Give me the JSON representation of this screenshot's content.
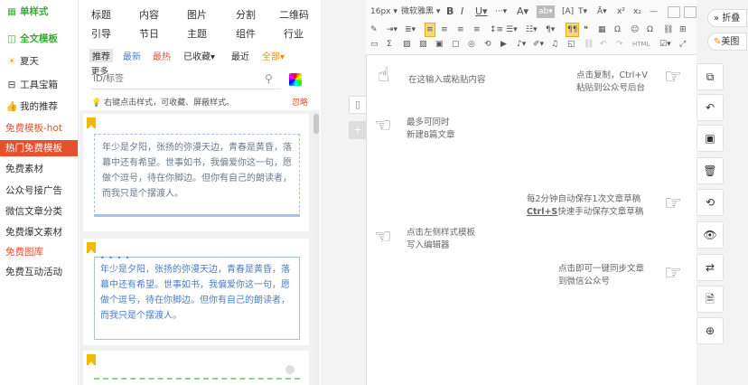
{
  "sidebar": {
    "items": [
      {
        "label": "单样式",
        "icon": "grid-icon",
        "color": "#3aa83a",
        "bold": true
      },
      {
        "label": "全文模板",
        "icon": "layout-icon",
        "color": "#3aa83a",
        "bold": true
      },
      {
        "label": "夏天",
        "icon": "sun-icon",
        "color": "#333",
        "bold": false
      },
      {
        "label": "工具宝箱",
        "icon": "toolbox-icon",
        "color": "#333",
        "bold": false
      },
      {
        "label": "我的推荐",
        "icon": "thumb-up-icon",
        "color": "#333",
        "bold": false
      },
      {
        "label": "免费模板-hot",
        "icon": "",
        "color": "#e8502d",
        "bold": false
      },
      {
        "label": "热门免费模板",
        "icon": "",
        "color": "#ffffff",
        "bold": false
      },
      {
        "label": "免费素材",
        "icon": "",
        "color": "#333",
        "bold": false
      },
      {
        "label": "公众号接广告",
        "icon": "",
        "color": "#333",
        "bold": false
      },
      {
        "label": "微信文章分类",
        "icon": "",
        "color": "#333",
        "bold": false
      },
      {
        "label": "免费爆文素材",
        "icon": "",
        "color": "#333",
        "bold": false
      },
      {
        "label": "免费图库",
        "icon": "",
        "color": "#e8502d",
        "bold": false
      },
      {
        "label": "免费互动活动",
        "icon": "",
        "color": "#333",
        "bold": false
      }
    ]
  },
  "categories": {
    "row1": [
      "标题",
      "内容",
      "图片",
      "分割",
      "二维码"
    ],
    "row2": [
      "引导",
      "节日",
      "主题",
      "组件",
      "行业"
    ]
  },
  "filters": {
    "items": [
      "推荐",
      "最新",
      "最热",
      "已收藏▾",
      "最近",
      "全部▾"
    ],
    "more": "更多"
  },
  "search": {
    "placeholder": "ID/标签"
  },
  "tip": {
    "text": "右键点击样式，可收藏、屏蔽样式。",
    "ignore": "忽略"
  },
  "templates": {
    "card1": "年少是夕阳，张扬的弥漫天边，青春是黄昏，落幕中还有希望。世事如书，我偏爱你这一句，愿做个逗号，待在你脚边。但你有自己的朗读者，而我只是个摆渡人。",
    "card2": "年少是夕阳，张扬的弥漫天边，青春是黄昏，落幕中还有希望。世事如书，我偏爱你这一句，愿做个逗号，待在你脚边。但你有自己的朗读者，而我只是个摆渡人。"
  },
  "toolbar": {
    "font_size": "16px",
    "font_family": "微软雅黑",
    "html_label": "HTML"
  },
  "hints": {
    "paste": "在这输入或粘贴内容",
    "copy1": "点击复制，Ctrl+V",
    "copy2": "粘贴到公众号后台",
    "multi1": "最多可同时",
    "multi2": "新建8篇文章",
    "auto1": "每2分钟自动保存1次文章草稿",
    "auto2_key": "Ctrl+S",
    "auto2_rest": "快速手动保存文章草稿",
    "left1": "点击左侧样式模板",
    "left2": "写入编辑器",
    "sync1": "点击即可一键同步文章",
    "sync2": "到微信公众号"
  },
  "rail": {
    "fold": "» 折叠",
    "beautify": "美图"
  },
  "colors": {
    "green": "#3aa83a",
    "orange": "#e8502d",
    "hot_bg": "#e8502d",
    "accent_blue": "#4a7fc1",
    "filter_orange": "#f08c00"
  }
}
